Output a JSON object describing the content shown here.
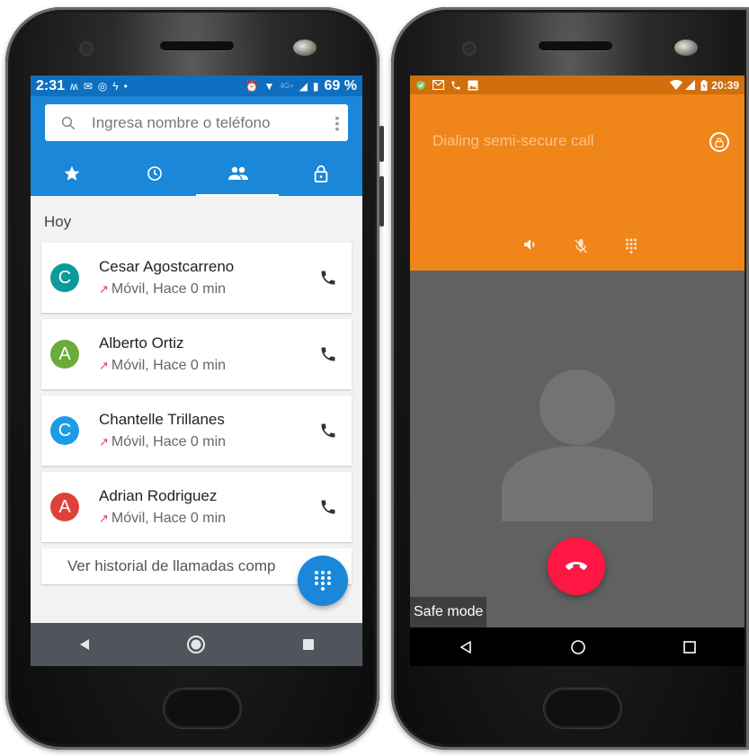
{
  "left_phone": {
    "status_bar": {
      "time": "2:31",
      "notification_icons": [
        "ʍ",
        "✉",
        "◎",
        "ϟ",
        "•"
      ],
      "right_icons": [
        "⏰",
        "▼",
        "4G+",
        "◢",
        "▮"
      ],
      "battery": "69 %"
    },
    "search": {
      "placeholder": "Ingresa nombre o teléfono"
    },
    "tabs": [
      {
        "name": "favorites",
        "icon": "star-icon"
      },
      {
        "name": "recents",
        "icon": "clock-icon",
        "active": true
      },
      {
        "name": "contacts",
        "icon": "people-icon"
      },
      {
        "name": "secure",
        "icon": "lock-icon"
      }
    ],
    "section_label": "Hoy",
    "calls": [
      {
        "initial": "C",
        "name": "Cesar Agostcarreno",
        "detail": "Móvil, Hace 0 min",
        "avatar_color": "#0d9a9d"
      },
      {
        "initial": "A",
        "name": "Alberto Ortiz",
        "detail": "Móvil, Hace 0 min",
        "avatar_color": "#6bab3b"
      },
      {
        "initial": "C",
        "name": "Chantelle Trillanes",
        "detail": "Móvil, Hace 0 min",
        "avatar_color": "#1e9be6"
      },
      {
        "initial": "A",
        "name": "Adrian Rodriguez",
        "detail": "Móvil, Hace 0 min",
        "avatar_color": "#e0403a"
      }
    ],
    "history_link": "Ver historial de llamadas comp",
    "accent_color": "#1a87d8"
  },
  "right_phone": {
    "status_bar": {
      "left_icons": [
        "shield-icon",
        "mail-icon",
        "phone-icon",
        "image-icon"
      ],
      "right_icons": [
        "wifi-icon",
        "signal-icon",
        "battery-icon"
      ],
      "time": "20:39"
    },
    "dial_status": "Dialing semi-secure call",
    "controls": [
      "speaker-icon",
      "mute-icon",
      "dialpad-icon"
    ],
    "safe_mode": "Safe mode",
    "accent_color": "#f08519",
    "end_call_color": "#ff1744"
  }
}
